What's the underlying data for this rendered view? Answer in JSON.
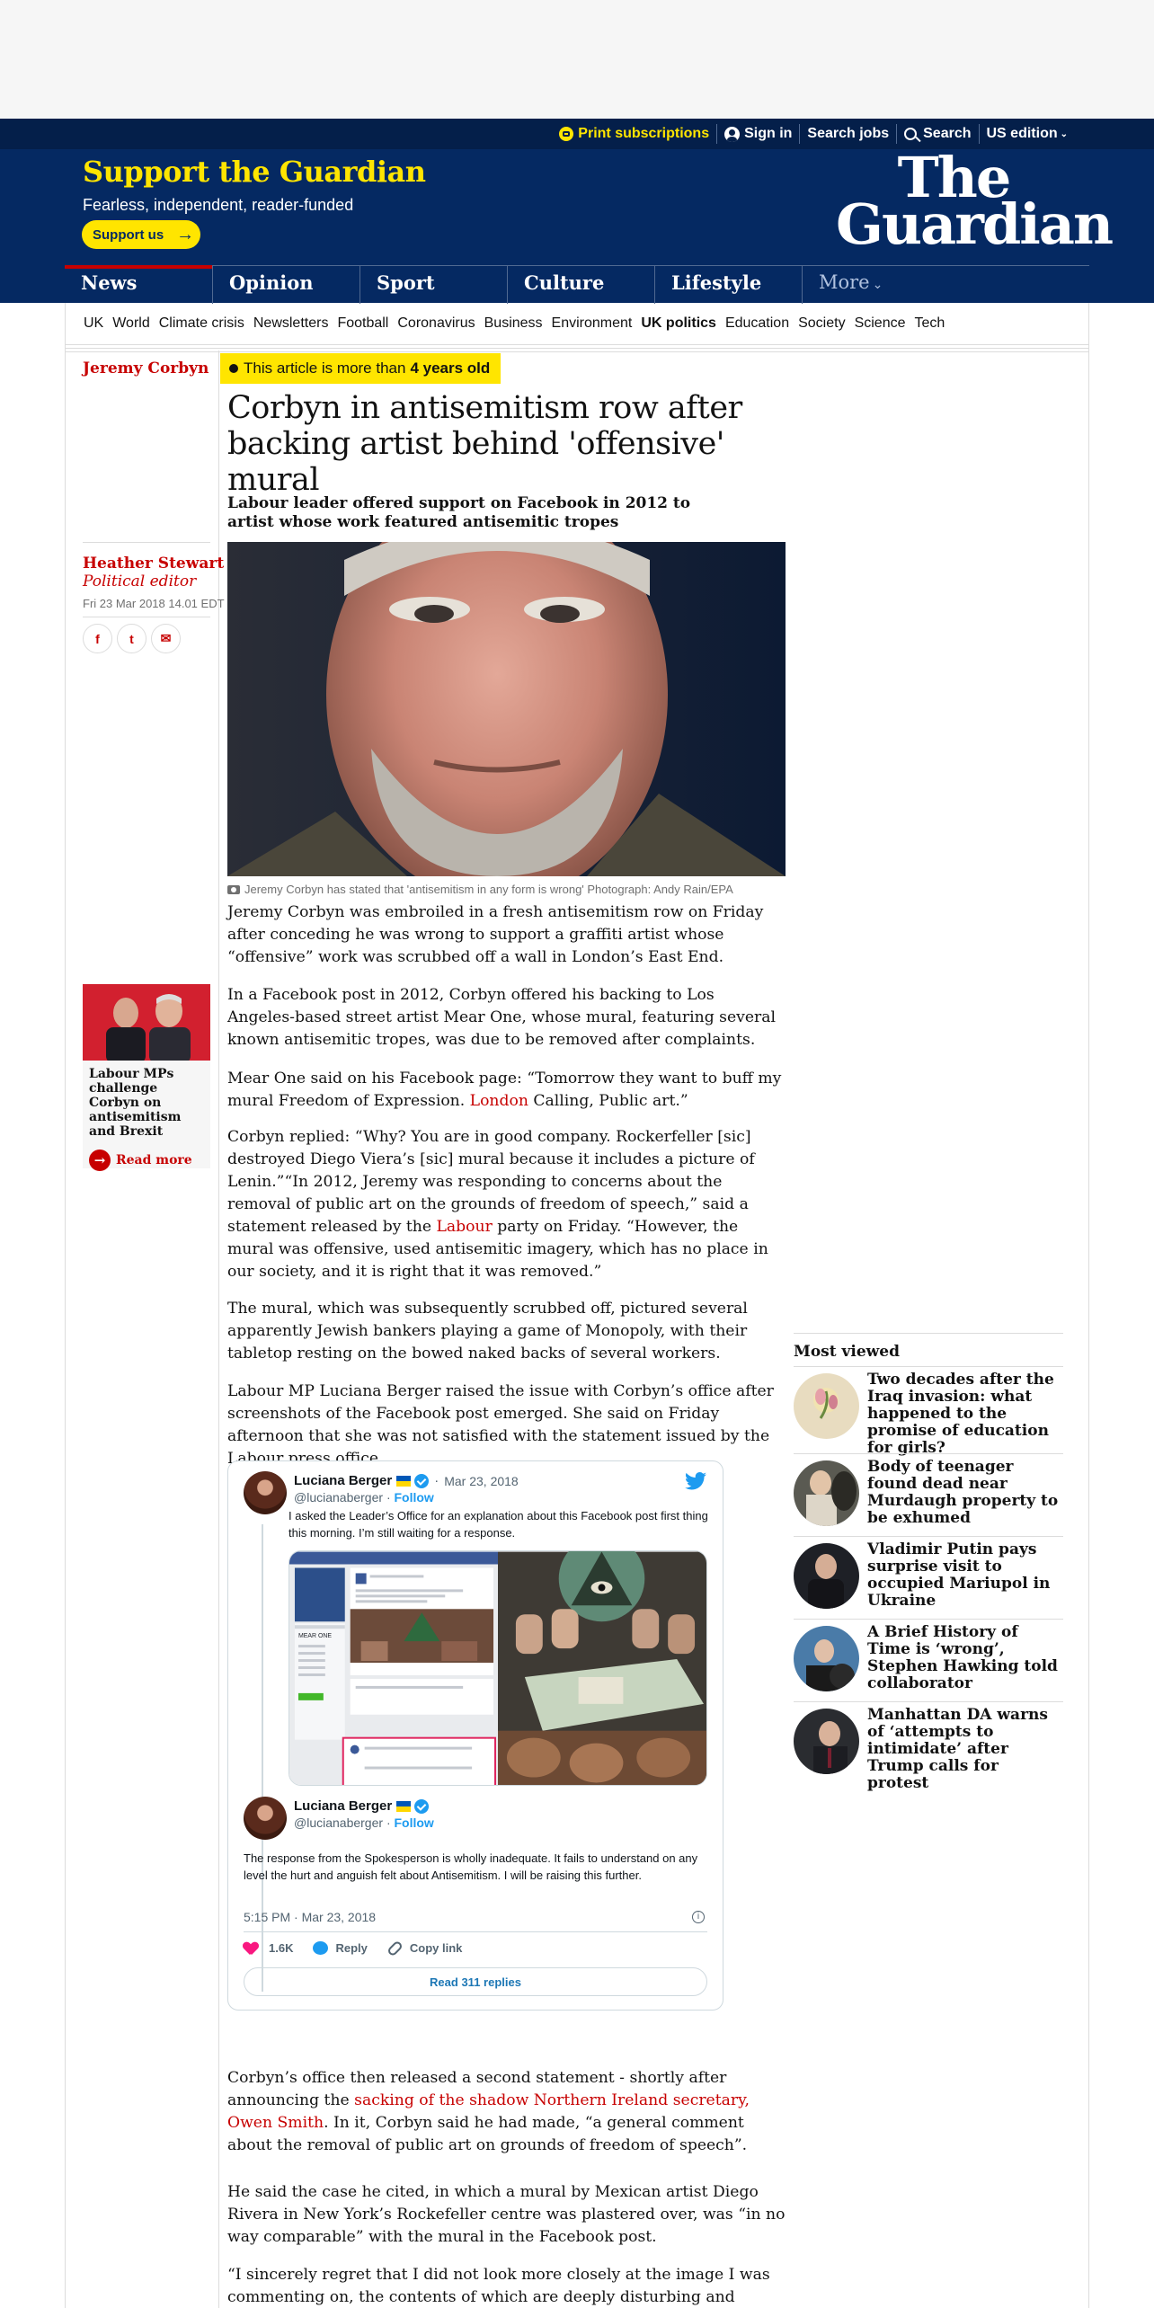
{
  "topbar": {
    "print": "Print subscriptions",
    "signin": "Sign in",
    "jobs": "Search jobs",
    "search": "Search",
    "edition": "US edition"
  },
  "support": {
    "title": "Support the Guardian",
    "subtitle": "Fearless, independent, reader-funded",
    "button": "Support us"
  },
  "logo": {
    "line1": "The",
    "line2": "Guardian"
  },
  "nav": [
    "News",
    "Opinion",
    "Sport",
    "Culture",
    "Lifestyle",
    "More"
  ],
  "subnav": [
    {
      "label": "UK",
      "bold": false
    },
    {
      "label": "World",
      "bold": false
    },
    {
      "label": "Climate crisis",
      "bold": false
    },
    {
      "label": "Newsletters",
      "bold": false
    },
    {
      "label": "Football",
      "bold": false
    },
    {
      "label": "Coronavirus",
      "bold": false
    },
    {
      "label": "Business",
      "bold": false
    },
    {
      "label": "Environment",
      "bold": false
    },
    {
      "label": "UK politics",
      "bold": true
    },
    {
      "label": "Education",
      "bold": false
    },
    {
      "label": "Society",
      "bold": false
    },
    {
      "label": "Science",
      "bold": false
    },
    {
      "label": "Tech",
      "bold": false
    }
  ],
  "article": {
    "kicker": "Jeremy Corbyn",
    "age_prefix": "This article is more than",
    "age_bold": "4 years old",
    "headline": "Corbyn in antisemitism row after backing artist behind 'offensive' mural",
    "standfirst": "Labour leader offered support on Facebook in 2012 to artist whose work featured antisemitic tropes",
    "byline_name": "Heather Stewart",
    "byline_role": "Political editor",
    "date": "Fri 23 Mar 2018 14.01 EDT",
    "share": [
      "f",
      "t",
      "✉"
    ],
    "caption": "Jeremy Corbyn has stated that 'antisemitism in any form is wrong' Photograph: Andy Rain/EPA",
    "p1": "Jeremy Corbyn was embroiled in a fresh antisemitism row on Friday after conceding he was wrong to support a graffiti artist whose “offensive” work was scrubbed off a wall in London’s East End.",
    "p2": "In a Facebook post in 2012, Corbyn offered his backing to Los Angeles-based street artist Mear One, whose mural, featuring several known antisemitic tropes, was due to be removed after complaints.",
    "p3_a": "Mear One said on his Facebook page: “Tomorrow they want to buff my mural Freedom of Expression. ",
    "p3_link": "London",
    "p3_b": " Calling, Public art.”",
    "p4_a": "Corbyn replied: “Why? You are in good company. Rockerfeller [sic] destroyed Diego Viera’s [sic] mural because it includes a picture of Lenin.”“In 2012, Jeremy was responding to concerns about the removal of public art on the grounds of freedom of speech,” said a statement released by the ",
    "p4_link": "Labour",
    "p4_b": " party on Friday. “However, the mural was offensive, used antisemitic imagery, which has no place in our society, and it is right that it was removed.”",
    "p5": "The mural, which was subsequently scrubbed off, pictured several apparently Jewish bankers playing a game of Monopoly, with their tabletop resting on the bowed naked backs of several workers.",
    "p6": "Labour MP Luciana Berger raised the issue with Corbyn’s office after screenshots of the Facebook post emerged. She said on Friday afternoon that she was not satisfied with the statement issued by the Labour press office.",
    "p7_a": "Corbyn’s office then released a second statement - shortly after announcing the ",
    "p7_link": "sacking of the shadow Northern Ireland secretary, Owen Smith",
    "p7_b": ". In it, Corbyn said he had made, “a general comment about the removal of public art on grounds of freedom of speech”.",
    "p8": "He said the case he cited, in which a mural by Mexican artist Diego Rivera in New York’s Rockefeller centre was plastered over, was “in no way comparable” with the mural in the Facebook post.",
    "p9": "“I sincerely regret that I did not look more closely at the image I was commenting on, the contents of which are deeply disturbing and"
  },
  "onward": {
    "title": "Labour MPs challenge Corbyn on antisemitism and Brexit",
    "read": "Read more"
  },
  "tweet": {
    "name": "Luciana Berger",
    "handle": "@lucianaberger",
    "dot": "·",
    "follow": "Follow",
    "date1": "Mar 23, 2018",
    "text1": "I asked the Leader’s Office for an explanation about this Facebook post first thing this morning.  I’m still waiting for a response.",
    "text2": "The response from the Spokesperson is wholly inadequate. It fails to understand on any level the hurt and anguish felt about Antisemitism.  I will be raising this further.",
    "timestamp": "5:15 PM · Mar 23, 2018",
    "likes": "1.6K",
    "reply": "Reply",
    "copy": "Copy link",
    "replies": "Read 311 replies",
    "fb_profile": "MEAR ONE"
  },
  "most_viewed": {
    "title": "Most viewed",
    "items": [
      "Two decades after the Iraq invasion: what happened to the promise of education for girls?",
      "Body of teenager found dead near Murdaugh property to be exhumed",
      "Vladimir Putin pays surprise visit to occupied Mariupol in Ukraine",
      "A Brief History of Time is ‘wrong’, Stephen Hawking told collaborator",
      "Manhattan DA warns of ‘attempts to intimidate’ after Trump calls for protest"
    ]
  },
  "colors": {
    "brand_blue": "#052962",
    "support_yellow": "#ffe500",
    "news_red": "#c70000",
    "twitter_blue": "#1d9bf0"
  }
}
